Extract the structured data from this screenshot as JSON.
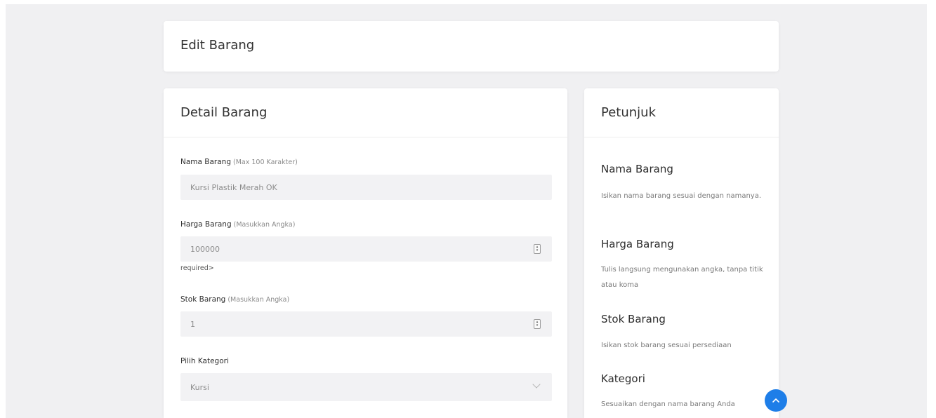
{
  "page": {
    "title": "Edit Barang"
  },
  "detail": {
    "title": "Detail Barang",
    "nama": {
      "label": "Nama Barang",
      "hint": "(Max 100 Karakter)",
      "value": "Kursi Plastik Merah OK"
    },
    "harga": {
      "label": "Harga Barang",
      "hint": "(Masukkan Angka)",
      "value": "100000",
      "note": "required>"
    },
    "stok": {
      "label": "Stok Barang",
      "hint": "(Masukkan Angka)",
      "value": "1"
    },
    "kategori": {
      "label": "Pilih Kategori",
      "value": "Kursi"
    }
  },
  "help": {
    "title": "Petunjuk",
    "items": [
      {
        "title": "Nama Barang",
        "text": "Isikan nama barang sesuai dengan namanya."
      },
      {
        "title": "Harga Barang",
        "text": "Tulis langsung mengunakan angka, tanpa titik atau koma"
      },
      {
        "title": "Stok Barang",
        "text": "Isikan stok barang sesuai persediaan"
      },
      {
        "title": "Kategori",
        "text": "Sesuaikan dengan nama barang Anda"
      }
    ]
  },
  "colors": {
    "accent": "#1e7ee8",
    "background": "#f0f0f2",
    "input": "#f2f2f4"
  },
  "icons": {
    "scroll_top": "chevron-up-icon",
    "select": "chevron-down-icon",
    "spinner": "spinner-icon"
  }
}
